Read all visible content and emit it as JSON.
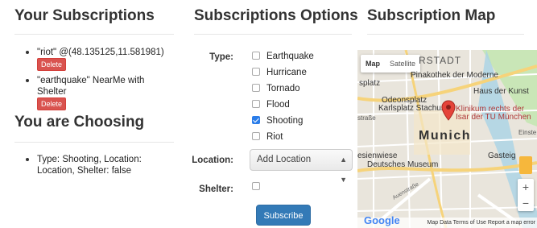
{
  "subscriptions": {
    "title": "Your Subscriptions",
    "items": [
      {
        "text": "\"riot\" @(48.135125,11.581981)",
        "delete_label": "Delete"
      },
      {
        "text": "\"earthquake\" NearMe with Shelter",
        "delete_label": "Delete"
      }
    ]
  },
  "choosing": {
    "title": "You are Choosing",
    "summary": "Type: Shooting, Location: Location, Shelter: false"
  },
  "options": {
    "title": "Subscriptions Options",
    "type_label": "Type:",
    "types": [
      {
        "label": "Earthquake",
        "checked": false
      },
      {
        "label": "Hurricane",
        "checked": false
      },
      {
        "label": "Tornado",
        "checked": false
      },
      {
        "label": "Flood",
        "checked": false
      },
      {
        "label": "Shooting",
        "checked": true
      },
      {
        "label": "Riot",
        "checked": false
      }
    ],
    "location_label": "Location:",
    "location_value": "Add Location",
    "shelter_label": "Shelter:",
    "subscribe_label": "Subscribe"
  },
  "map": {
    "title": "Subscription Map",
    "toggle_map": "Map",
    "toggle_satellite": "Satellite",
    "places": {
      "p1": "RSTADT",
      "p2": "Pinakothek der Moderne",
      "p3": "splatz",
      "p4": "Haus der Kunst",
      "p5": "Odeonsplatz",
      "p6": "Karlsplatz Stachus",
      "p7": "Klinikum rechts der",
      "p8": "Isar der TU München",
      "p9": "straße",
      "p10": "Munich",
      "p11": "Einste",
      "p12": "esienwiese",
      "p13": "Gasteig",
      "p14": "Deutsches Museum",
      "p15": "Auenstraße"
    },
    "zoom_in": "+",
    "zoom_out": "−",
    "logo": "Google",
    "footer": "Map Data   Terms of Use   Report a map error",
    "accent_pin": "#e5443a"
  }
}
